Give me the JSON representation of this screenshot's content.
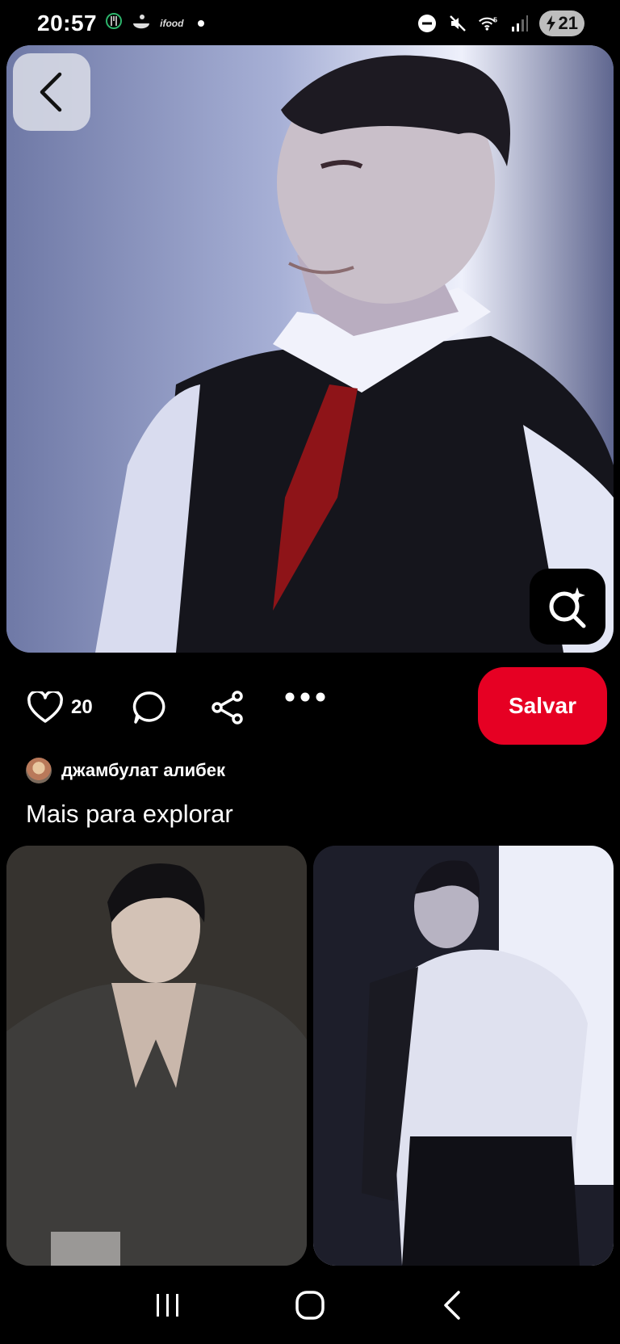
{
  "status_bar": {
    "time": "20:57",
    "app_label": "ifood",
    "battery": "21",
    "wifi_badge": "5"
  },
  "pin": {
    "like_count": "20",
    "save_label": "Salvar",
    "author": "джамбулат алибек"
  },
  "section": {
    "title": "Mais para explorar"
  },
  "colors": {
    "accent": "#e60023",
    "background": "#000000"
  },
  "icons": [
    "back-icon",
    "visual-search-icon",
    "heart-icon",
    "comment-icon",
    "share-icon",
    "more-icon",
    "recents-icon",
    "home-icon",
    "nav-back-icon"
  ]
}
